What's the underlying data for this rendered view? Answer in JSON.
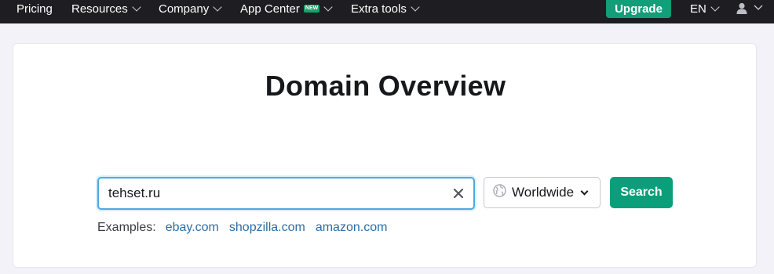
{
  "nav": {
    "items": [
      {
        "label": "Pricing",
        "has_dropdown": false
      },
      {
        "label": "Resources",
        "has_dropdown": true
      },
      {
        "label": "Company",
        "has_dropdown": true
      },
      {
        "label": "App Center",
        "badge": "NEW",
        "has_dropdown": true
      },
      {
        "label": "Extra tools",
        "has_dropdown": true
      }
    ],
    "upgrade_label": "Upgrade",
    "language": "EN",
    "user_icon": "user-icon"
  },
  "main": {
    "title": "Domain Overview",
    "search": {
      "value": "tehset.ru",
      "clear_icon": "close-icon"
    },
    "region": {
      "selected": "Worldwide",
      "icon": "globe-icon"
    },
    "search_button": "Search",
    "examples": {
      "label": "Examples:",
      "links": [
        "ebay.com",
        "shopzilla.com",
        "amazon.com"
      ]
    }
  },
  "colors": {
    "topbar": "#1e1e22",
    "upgrade": "#129e78",
    "search_button": "#0a9f7a",
    "link": "#2b6ea6",
    "new_badge": "#15a36b"
  }
}
